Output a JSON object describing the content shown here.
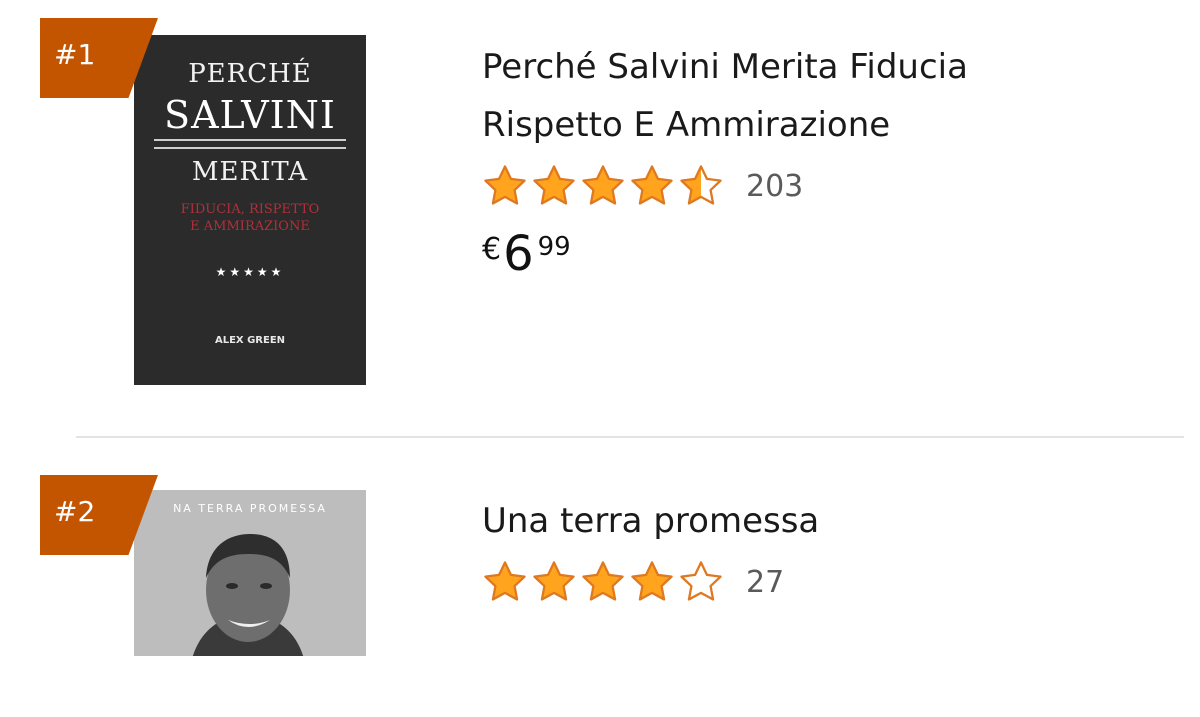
{
  "colors": {
    "rank_badge": "#c45500",
    "star_fill": "#ffa41c",
    "star_outline": "#de7921"
  },
  "items": [
    {
      "rank": "#1",
      "title_line_1": "Perché Salvini Merita Fiducia",
      "title_line_2": "Rispetto E Ammirazione",
      "rating_stars": 4.5,
      "rating_count": "203",
      "price_symbol": "€",
      "price_whole": "6",
      "price_fraction": "99",
      "cover": {
        "line_1": "PERCHÉ",
        "line_2": "SALVINI",
        "line_3": "MERITA",
        "subtitle_1": "FIDUCIA, RISPETTO",
        "subtitle_2": "E AMMIRAZIONE",
        "stars": "★★★★★",
        "tagline": "",
        "author": "ALEX GREEN",
        "author_role": ""
      }
    },
    {
      "rank": "#2",
      "title_line_1": "Una terra promessa",
      "rating_stars": 4,
      "rating_count": "27",
      "cover": {
        "title": "NA TERRA PROMESSA"
      }
    }
  ]
}
